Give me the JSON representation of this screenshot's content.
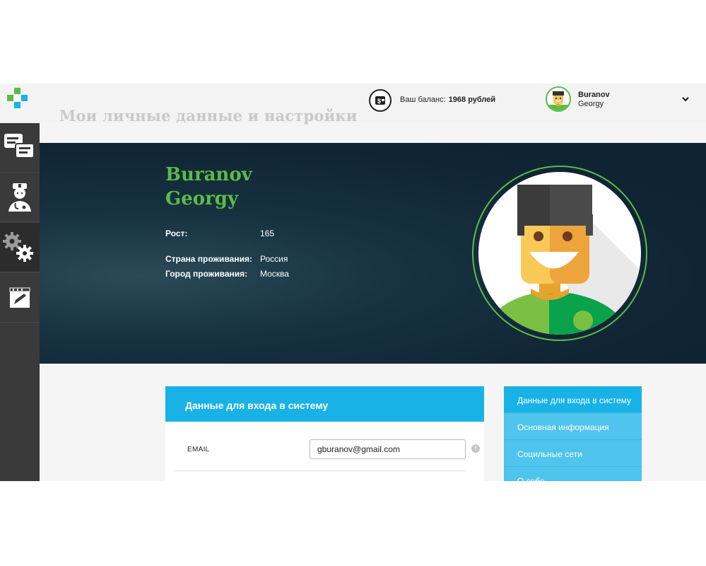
{
  "header": {
    "page_title": "Мои личные данные и настройки",
    "balance_label": "Ваш баланс:",
    "balance_value": "1968 рублей",
    "user_first": "Buranov",
    "user_last": "Georgy"
  },
  "sidebar": {
    "items": [
      {
        "icon": "chat-icon"
      },
      {
        "icon": "doctor-icon"
      },
      {
        "icon": "gears-icon",
        "active": true
      },
      {
        "icon": "edit-calendar-icon"
      }
    ]
  },
  "profile": {
    "first_name": "Buranov",
    "last_name": "Georgy",
    "height_label": "Рост:",
    "height_value": "165",
    "country_label": "Страна проживания:",
    "country_value": "Россия",
    "city_label": "Город проживания:",
    "city_value": "Москва"
  },
  "login_card": {
    "title": "Данные для входа в систему",
    "email_label": "EMAIL",
    "email_value": "gburanov@gmail.com"
  },
  "right_menu": {
    "items": [
      "Данные для входа в систему",
      "Основная информация",
      "Социльные сети",
      "О себе"
    ]
  },
  "colors": {
    "accent_blue": "#19b2e6",
    "accent_green": "#5dbb46",
    "sidebar": "#3a3a3a",
    "hero": "#102534"
  }
}
